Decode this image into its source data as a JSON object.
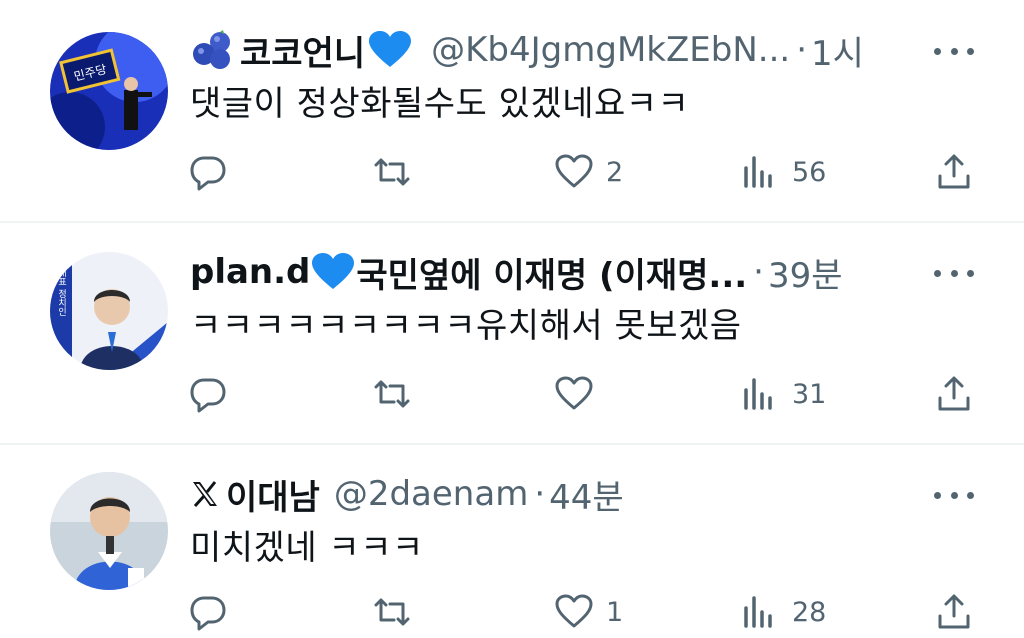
{
  "posts": [
    {
      "name": "코코언니",
      "handle": "@Kb4JgmgMkZEbN...",
      "time": "1시",
      "text": "댓글이 정상화될수도 있겠네요ㅋㅋ",
      "stats": {
        "replies": "",
        "retweets": "",
        "likes": "2",
        "views": "56"
      },
      "avatar_text": "민주당"
    },
    {
      "name": "plan.d",
      "name_suffix": "국민옆에 이재명 (이재명...",
      "handle": "",
      "time": "39분",
      "text": "ㅋㅋㅋㅋㅋㅋㅋㅋㅋ유치해서 못보겠음",
      "stats": {
        "replies": "",
        "retweets": "",
        "likes": "",
        "views": "31"
      },
      "avatar_text": "대표 정치인"
    },
    {
      "name": "이대남",
      "handle": "@2daenam",
      "time": "44분",
      "text": "미치겠네 ㅋㅋㅋ",
      "stats": {
        "replies": "",
        "retweets": "",
        "likes": "1",
        "views": "28"
      },
      "avatar_text": ""
    }
  ],
  "separator": "·",
  "colors": {
    "heart_emoji": "#1d8cf0",
    "muted": "#536471",
    "text": "#0f1419"
  }
}
